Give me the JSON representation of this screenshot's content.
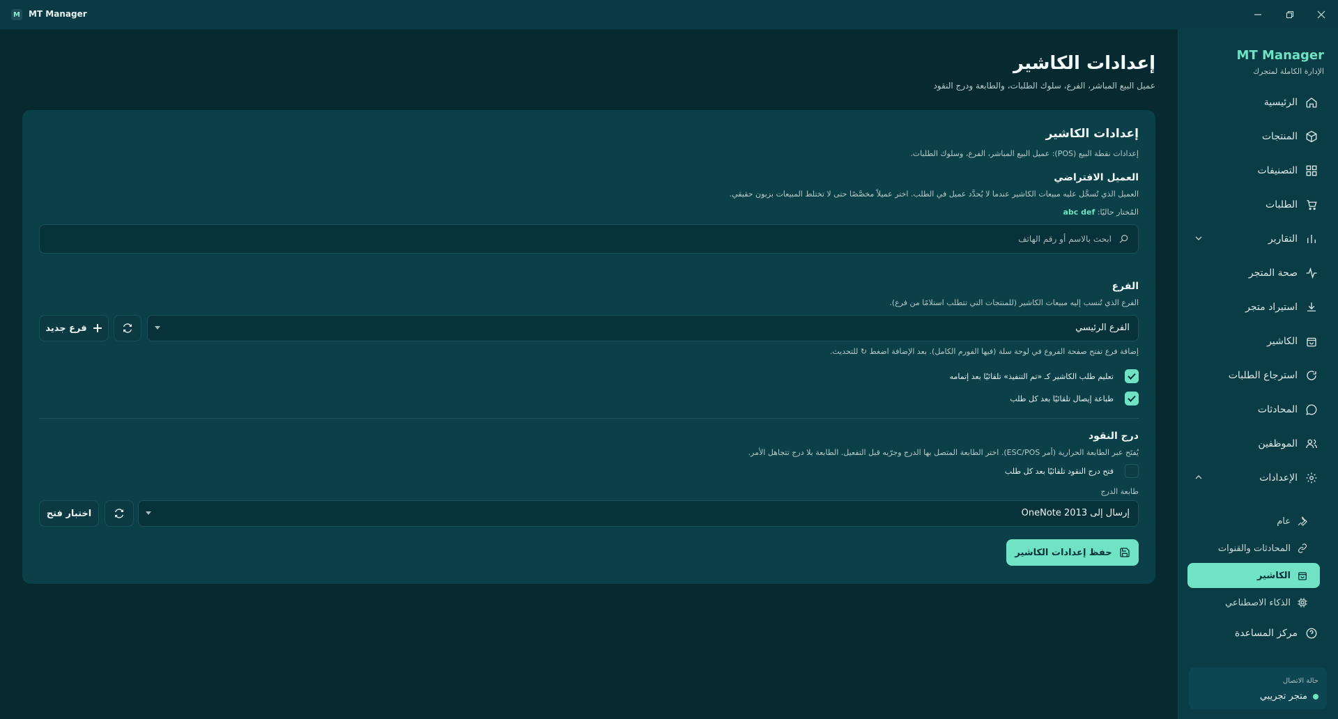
{
  "window": {
    "title": "MT Manager",
    "logo_letter": "M"
  },
  "sidebar": {
    "brand_name": "MT Manager",
    "brand_sub": "الإدارة الكاملة لمتجرك",
    "items": [
      {
        "label": "الرئيسية",
        "icon": "home-icon"
      },
      {
        "label": "المنتجات",
        "icon": "box-icon"
      },
      {
        "label": "التصنيفات",
        "icon": "grid-icon"
      },
      {
        "label": "الطلبات",
        "icon": "cart-icon"
      },
      {
        "label": "التقارير",
        "icon": "bar-chart-icon"
      },
      {
        "label": "صحة المتجر",
        "icon": "pulse-icon"
      },
      {
        "label": "استيراد متجر",
        "icon": "download-icon"
      },
      {
        "label": "الكاشير",
        "icon": "shopping-bag-icon"
      },
      {
        "label": "استرجاع الطلبات",
        "icon": "refresh-icon"
      },
      {
        "label": "المحادثات",
        "icon": "chat-icon"
      },
      {
        "label": "الموظفين",
        "icon": "users-icon"
      },
      {
        "label": "الإعدادات",
        "icon": "gear-icon"
      }
    ],
    "settings_sub": [
      {
        "label": "عام",
        "icon": "wrench-icon"
      },
      {
        "label": "المحادثات والقنوات",
        "icon": "link-icon"
      },
      {
        "label": "الكاشير",
        "icon": "shopping-bag-icon",
        "active": true
      },
      {
        "label": "الذكاء الاصطناعي",
        "icon": "chip-icon"
      }
    ],
    "help": {
      "label": "مركز المساعدة",
      "icon": "help-icon"
    },
    "status": {
      "label": "حالة الاتصال",
      "value": "متجر تجريبي"
    }
  },
  "page": {
    "title": "إعدادات الكاشير",
    "subtitle": "عميل البيع المباشر، الفرع، سلوك الطلبات، والطابعة ودرج النقود"
  },
  "card": {
    "title": "إعدادات الكاشير",
    "desc": "إعدادات نقطة البيع (POS): عميل البيع المباشر، الفرع، وسلوك الطلبات.",
    "default_customer": {
      "heading": "العميل الافتراضي",
      "desc": "العميل الذي تُسجَّل عليه مبيعات الكاشير عندما لا يُحدَّد عميل في الطلب. اختر عميلاً مخصَّصًا حتى لا تختلط المبيعات بزبون حقيقي.",
      "current_label": "المُختار حاليًا:",
      "current_value": "abc def",
      "search_placeholder": "ابحث بالاسم أو رقم الهاتف"
    },
    "branch": {
      "heading": "الفرع",
      "desc": "الفرع الذي تُنسب إليه مبيعات الكاشير (للمنتجات التي تتطلب استلامًا من فرع).",
      "selected": "الفرع الرئيسي",
      "new_button": "فرع جديد",
      "note": "إضافة فرع تفتح صفحة الفروع في لوحة سلة (فيها الفورم الكامل). بعد الإضافة اضغط ↻ للتحديث.",
      "checks": [
        {
          "label": "تعليم طلب الكاشير كـ «تم التنفيذ» تلقائيًا بعد إتمامه",
          "checked": true
        },
        {
          "label": "طباعة إيصال تلقائيًا بعد كل طلب",
          "checked": true
        }
      ]
    },
    "drawer": {
      "heading": "درج النقود",
      "desc": "يُفتَح عبر الطابعة الحرارية (أمر ESC/POS). اختر الطابعة المتصل بها الدرج وجرّبه قبل التفعيل. الطابعة بلا درج تتجاهل الأمر.",
      "check": {
        "label": "فتح درج النقود تلقائيًا بعد كل طلب",
        "checked": false
      },
      "printer_label": "طابعة الدرج",
      "printer_selected": "إرسال إلى OneNote 2013",
      "test_button": "اختبار فتح"
    },
    "save_button": "حفظ إعدادات الكاشير"
  }
}
